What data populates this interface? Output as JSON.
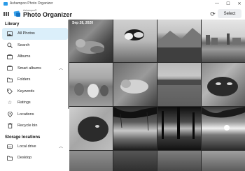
{
  "window": {
    "title": "Ashampoo Photo Organizer"
  },
  "window_controls": [
    "—",
    "☐",
    "✕"
  ],
  "header": {
    "brand_small": "Ashampoo®",
    "brand_name": "Photo Organizer",
    "select_label": "Select"
  },
  "sidebar": {
    "library_title": "Library",
    "items": [
      {
        "label": "All Photos",
        "icon": "photos-icon"
      },
      {
        "label": "Search",
        "icon": "search-icon"
      },
      {
        "label": "Albums",
        "icon": "albums-icon"
      },
      {
        "label": "Smart albums",
        "icon": "smart-albums-icon"
      },
      {
        "label": "Folders",
        "icon": "folder-icon"
      },
      {
        "label": "Keywords",
        "icon": "tag-icon"
      },
      {
        "label": "Ratings",
        "icon": "star-icon"
      },
      {
        "label": "Locations",
        "icon": "location-pin-icon"
      },
      {
        "label": "Recycle bin",
        "icon": "trash-icon"
      }
    ],
    "storage_title": "Storage locations",
    "storage_items": [
      {
        "label": "Local drive",
        "icon": "drive-icon"
      },
      {
        "label": "Desktop",
        "icon": "desktop-icon"
      }
    ]
  },
  "grid": {
    "date_label": "Sep 28, 2020",
    "photos": [
      "cat lying on carpet",
      "black and white cat",
      "mountain landscape",
      "river town",
      "alpacas in field",
      "cat lying on rock",
      "green meadow",
      "cat close-up",
      "cat portrait",
      "sunset under tree",
      "sunset behind trees",
      "sunset over lake"
    ]
  }
}
